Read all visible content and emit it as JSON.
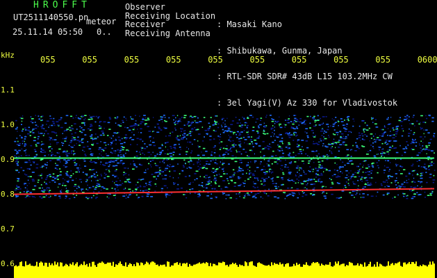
{
  "header": {
    "app_title": "HROFFT",
    "file_name": "UT2511140550.pn",
    "meteor_label": "meteor",
    "timestamp": "25.11.14 05:50",
    "count": "0..",
    "info": [
      {
        "label": "Observer",
        "value": ": Masaki Kano"
      },
      {
        "label": "Receiving Location",
        "value": ": Shibukawa, Gunma, Japan"
      },
      {
        "label": "Receiver",
        "value": ": RTL-SDR SDR# 43dB L15 103.2MHz CW"
      },
      {
        "label": "Receiving Antenna",
        "value": ": 3el Yagi(V) Az 330 for Vladivostok"
      }
    ]
  },
  "colors": {
    "label": "#f0ff40",
    "title": "#4cff4c",
    "text": "#e8e8e8",
    "spectrum_low": "#0a1a8c",
    "spectrum_mid": "#1e6cff",
    "spectrum_high": "#3cff7a",
    "line_red": "#ff3030",
    "amplitude": "#ffff00"
  },
  "chart_data": {
    "type": "heatmap",
    "ylabel": "kHz",
    "y_ticks": [
      "1.1",
      "1.0",
      "0.9",
      "0.8",
      "0.7",
      "0.6"
    ],
    "x_ticks": [
      "055",
      "055",
      "055",
      "055",
      "055",
      "055",
      "055",
      "055",
      "055",
      "0600"
    ],
    "ylim": [
      0.6,
      1.15
    ],
    "signal_band_khz": [
      0.79,
      1.03
    ],
    "carrier_lines_khz": [
      0.905,
      0.805
    ],
    "grid": false
  }
}
